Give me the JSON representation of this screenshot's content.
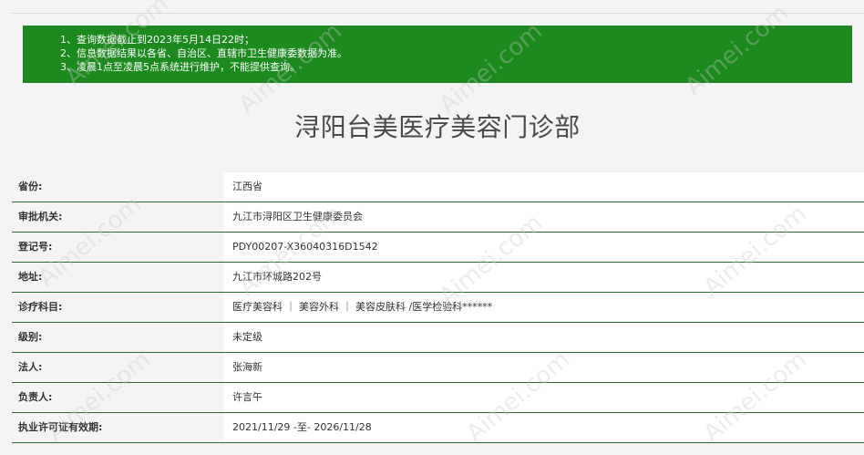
{
  "notice": {
    "lines": [
      "1、查询数据截止到2023年5月14日22时；",
      "2、信息数据结果以各省、自治区、直辖市卫生健康委数据为准。",
      "3、凌晨1点至凌晨5点系统进行维护，不能提供查询。"
    ],
    "background_color": "#1d8a20"
  },
  "title": "浔阳台美医疗美容门诊部",
  "rows": [
    {
      "label": "省份:",
      "value": "江西省"
    },
    {
      "label": "审批机关:",
      "value": "九江市浔阳区卫生健康委员会"
    },
    {
      "label": "登记号:",
      "value": "PDY00207-X36040316D1542"
    },
    {
      "label": "地址:",
      "value": "九江市环城路202号"
    },
    {
      "label": "诊疗科目:",
      "value": "医疗美容科 ｜ 美容外科 ｜ 美容皮肤科 /医学检验科******"
    },
    {
      "label": "级别:",
      "value": "未定级"
    },
    {
      "label": "法人:",
      "value": "张海新"
    },
    {
      "label": "负责人:",
      "value": "许言午"
    },
    {
      "label": "执业许可证有效期:",
      "value": "2021/11/29 -至- 2026/11/28"
    }
  ],
  "watermark": "Aimei.com"
}
